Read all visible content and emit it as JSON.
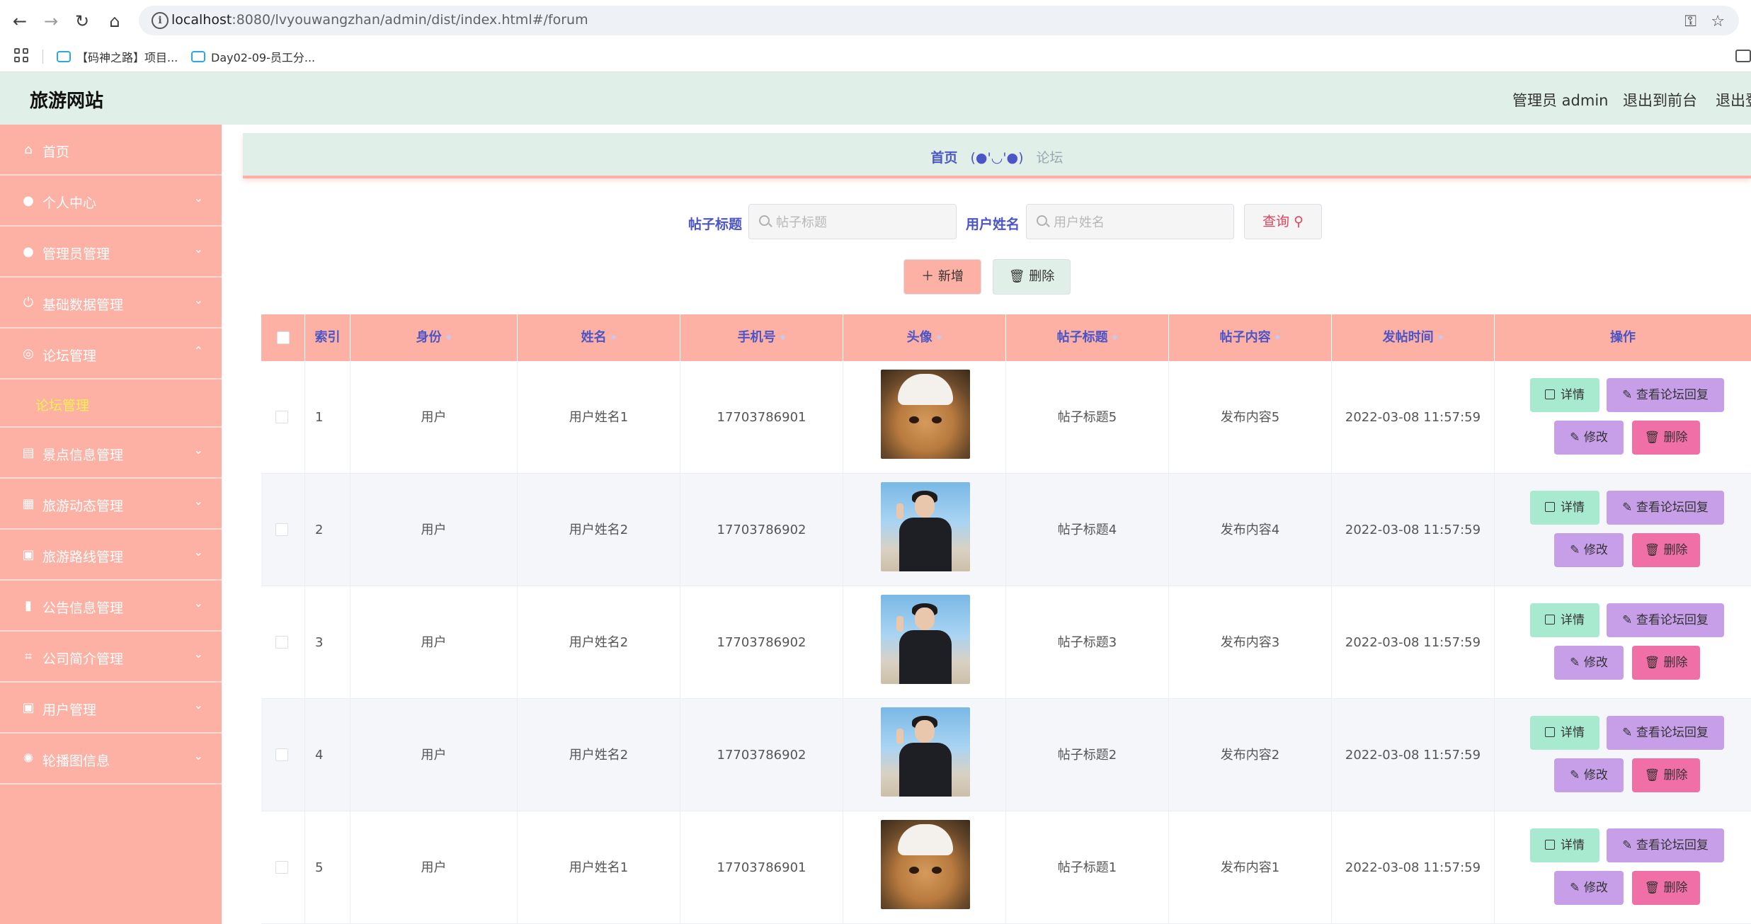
{
  "browser": {
    "url_host": "localhost",
    "url_rest": ":8080/lvyouwangzhan/admin/dist/index.html#/forum",
    "bookmarks": [
      "【码神之路】项目...",
      "Day02-09-员工分..."
    ]
  },
  "header": {
    "title": "旅游网站",
    "admin_label": "管理员 admin",
    "to_front": "退出到前台",
    "logout": "退出登录"
  },
  "sidebar": {
    "items": [
      {
        "label": "首页",
        "icon": "home-icon",
        "has_chevron": false
      },
      {
        "label": "个人中心",
        "icon": "user-icon",
        "has_chevron": true
      },
      {
        "label": "管理员管理",
        "icon": "location-icon",
        "has_chevron": true
      },
      {
        "label": "基础数据管理",
        "icon": "power-icon",
        "has_chevron": true
      },
      {
        "label": "论坛管理",
        "icon": "compass-icon",
        "has_chevron": true,
        "expanded": true
      },
      {
        "label": "景点信息管理",
        "icon": "clipboard-icon",
        "has_chevron": true
      },
      {
        "label": "旅游动态管理",
        "icon": "grid-icon",
        "has_chevron": true
      },
      {
        "label": "旅游路线管理",
        "icon": "clipboard-x-icon",
        "has_chevron": true
      },
      {
        "label": "公告信息管理",
        "icon": "bar-chart-icon",
        "has_chevron": true
      },
      {
        "label": "公司简介管理",
        "icon": "crop-icon",
        "has_chevron": true
      },
      {
        "label": "用户管理",
        "icon": "clipboard-check-icon",
        "has_chevron": true
      },
      {
        "label": "轮播图信息",
        "icon": "dial-icon",
        "has_chevron": true
      }
    ],
    "sub_item": "论坛管理"
  },
  "breadcrumb": {
    "home": "首页",
    "separator": "(●'◡'●)",
    "current": "论坛"
  },
  "search": {
    "title_label": "帖子标题",
    "title_placeholder": "帖子标题",
    "name_label": "用户姓名",
    "name_placeholder": "用户姓名",
    "query_label": "查询"
  },
  "actions": {
    "add_label": "新增",
    "delete_label": "删除"
  },
  "table": {
    "columns": [
      "索引",
      "身份",
      "姓名",
      "手机号",
      "头像",
      "帖子标题",
      "帖子内容",
      "发帖时间",
      "操作"
    ],
    "rows": [
      {
        "index": "1",
        "role": "用户",
        "name": "用户姓名1",
        "phone": "17703786901",
        "avatar": "cat-photo",
        "title": "帖子标题5",
        "content": "发布内容5",
        "time": "2022-03-08 11:57:59"
      },
      {
        "index": "2",
        "role": "用户",
        "name": "用户姓名2",
        "phone": "17703786902",
        "avatar": "person-photo",
        "title": "帖子标题4",
        "content": "发布内容4",
        "time": "2022-03-08 11:57:59"
      },
      {
        "index": "3",
        "role": "用户",
        "name": "用户姓名2",
        "phone": "17703786902",
        "avatar": "person-photo",
        "title": "帖子标题3",
        "content": "发布内容3",
        "time": "2022-03-08 11:57:59"
      },
      {
        "index": "4",
        "role": "用户",
        "name": "用户姓名2",
        "phone": "17703786902",
        "avatar": "person-photo",
        "title": "帖子标题2",
        "content": "发布内容2",
        "time": "2022-03-08 11:57:59"
      },
      {
        "index": "5",
        "role": "用户",
        "name": "用户姓名1",
        "phone": "17703786901",
        "avatar": "cat-photo",
        "title": "帖子标题1",
        "content": "发布内容1",
        "time": "2022-03-08 11:57:59"
      }
    ],
    "op_labels": {
      "detail": "详情",
      "reply": "查看论坛回复",
      "edit": "修改",
      "delete": "删除"
    }
  },
  "colors": {
    "sidebar_bg": "#fdb0a4",
    "header_bg": "#e0efe8",
    "accent_text": "#4b55c7",
    "active_sub": "#f7f24d",
    "detail_btn": "#a8ead0",
    "reply_edit_btn": "#c79ee8",
    "delete_btn": "#f06fa6"
  }
}
